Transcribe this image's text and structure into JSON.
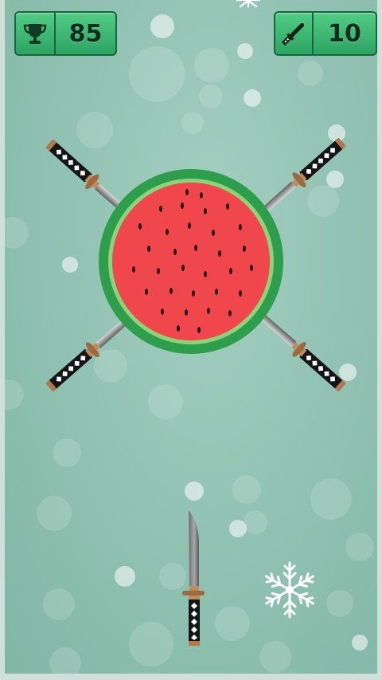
{
  "hud": {
    "score": "85",
    "score_icon": "trophy-icon",
    "knives_left": "10",
    "knives_icon": "knife-icon"
  },
  "target": {
    "type": "watermelon",
    "stuck_knives": 4
  },
  "colors": {
    "hud_green": "#3fb874",
    "hud_border": "#17663f",
    "rind": "#2f9e4c",
    "flesh": "#f0474c",
    "background": "#93c3b4"
  }
}
